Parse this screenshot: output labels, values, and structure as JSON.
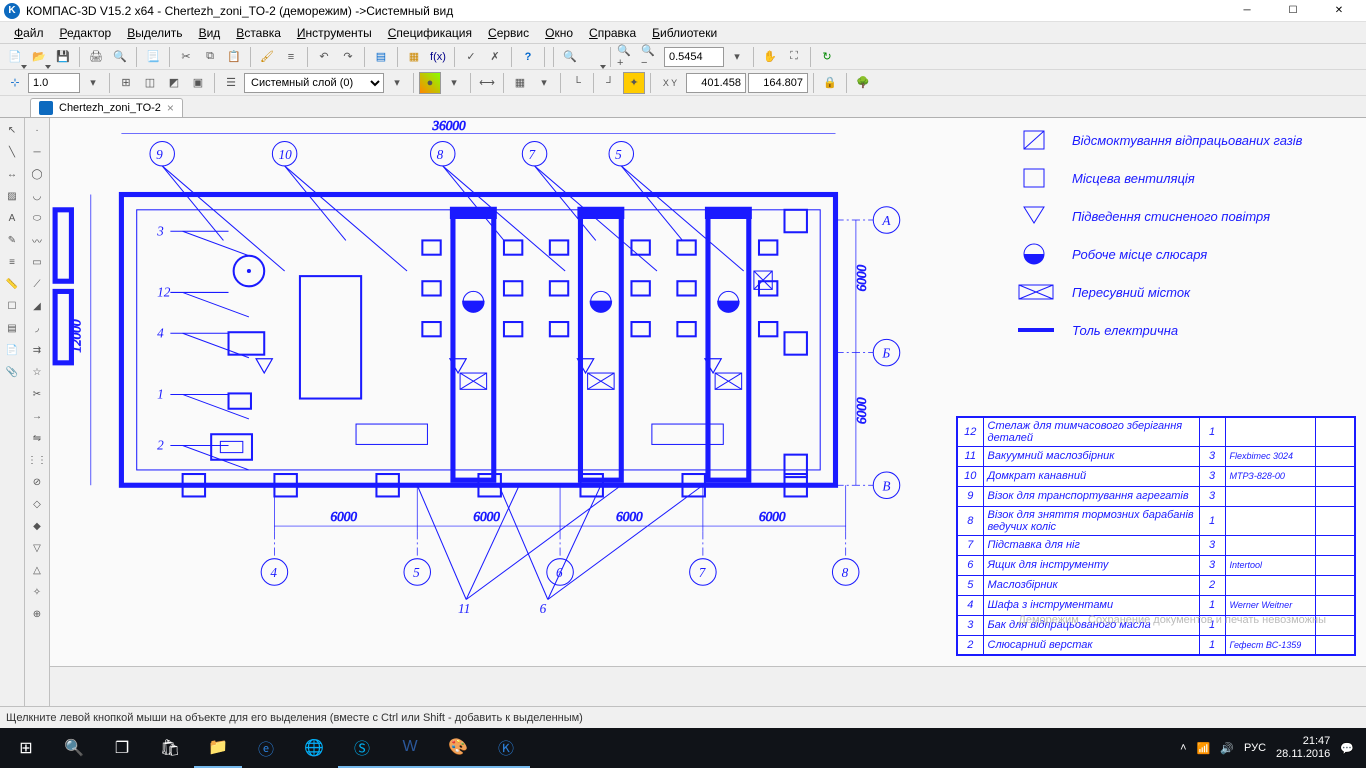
{
  "title": "КОМПАС-3D V15.2  x64 - Chertezh_zoni_TO-2 (деморежим) ->Системный вид",
  "menu": [
    "Файл",
    "Редактор",
    "Выделить",
    "Вид",
    "Вставка",
    "Инструменты",
    "Спецификация",
    "Сервис",
    "Окно",
    "Справка",
    "Библиотеки"
  ],
  "doc_tab": "Chertezh_zoni_TO-2",
  "toolbar": {
    "zoom_value": "0.5454",
    "line_width": "1.0",
    "layer_label": "Системный слой (0)",
    "coord_x": "401.458",
    "coord_y": "164.807"
  },
  "status": "Щелкните левой кнопкой мыши на объекте для его выделения (вместе с Ctrl или Shift - добавить к выделенным)",
  "tray": {
    "lang": "РУС",
    "time": "21:47",
    "date": "28.11.2016"
  },
  "legend": [
    {
      "sym": "diag",
      "text": "Відсмоктування відпрацьованих газів"
    },
    {
      "sym": "square",
      "text": "Місцева вентиляція"
    },
    {
      "sym": "tri",
      "text": "Підведення стисненого повітря"
    },
    {
      "sym": "circle",
      "text": "Робоче місце слюсаря"
    },
    {
      "sym": "cross",
      "text": "Пересувний місток"
    },
    {
      "sym": "bar",
      "text": "Толь електрична"
    }
  ],
  "spec": [
    {
      "n": "12",
      "name": "Стелаж для тимчасового зберігання деталей",
      "q": "1",
      "note": ""
    },
    {
      "n": "11",
      "name": "Вакуумний маслозбірник",
      "q": "3",
      "note": "Flexbimec 3024"
    },
    {
      "n": "10",
      "name": "Домкрат канавний",
      "q": "3",
      "note": "МТРЗ-828-00"
    },
    {
      "n": "9",
      "name": "Візок для транспортування агрегатів",
      "q": "3",
      "note": ""
    },
    {
      "n": "8",
      "name": "Візок для зняття тормозних барабанів ведучих коліс",
      "q": "1",
      "note": ""
    },
    {
      "n": "7",
      "name": "Підставка для ніг",
      "q": "3",
      "note": ""
    },
    {
      "n": "6",
      "name": "Ящик для інструменту",
      "q": "3",
      "note": "Intertool"
    },
    {
      "n": "5",
      "name": "Маслозбірник",
      "q": "2",
      "note": ""
    },
    {
      "n": "4",
      "name": "Шафа з інструментами",
      "q": "1",
      "note": "Werner Weitner"
    },
    {
      "n": "3",
      "name": "Бак для відпрацьованого масла",
      "q": "1",
      "note": ""
    },
    {
      "n": "2",
      "name": "Слюсарний верстак",
      "q": "1",
      "note": "Гефест ВС-1359"
    }
  ],
  "drawing": {
    "overall_w": "36000",
    "overall_h": "12000",
    "bay_dims": [
      "6000",
      "6000",
      "6000",
      "6000"
    ],
    "h_dims": [
      "6000",
      "6000"
    ],
    "axes_h": [
      "А",
      "Б",
      "В"
    ],
    "callouts_top": [
      "9",
      "10",
      "8",
      "7",
      "5"
    ],
    "callouts_left": [
      "3",
      "12",
      "4",
      "1",
      "2"
    ],
    "callouts_bottom": [
      "4",
      "5",
      "6",
      "7",
      "8"
    ],
    "callouts_under": [
      "11",
      "6"
    ]
  }
}
